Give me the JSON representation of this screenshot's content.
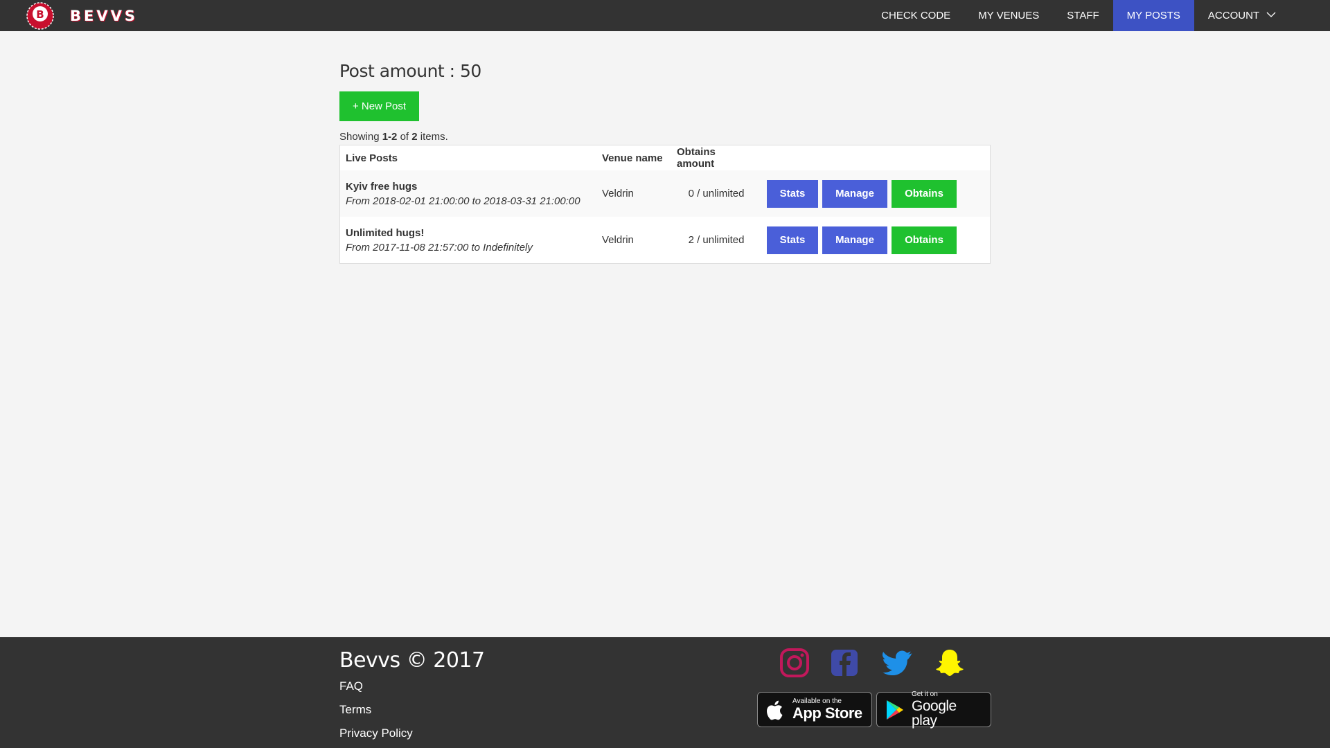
{
  "brand": {
    "name": "BEVVS"
  },
  "nav": {
    "items": [
      {
        "label": "CHECK CODE",
        "active": false
      },
      {
        "label": "MY VENUES",
        "active": false
      },
      {
        "label": "STAFF",
        "active": false
      },
      {
        "label": "MY POSTS",
        "active": true
      },
      {
        "label": "ACCOUNT",
        "active": false
      }
    ]
  },
  "main": {
    "title": "Post amount : 50",
    "new_post_label": "+ New Post",
    "summary": {
      "prefix": "Showing ",
      "range": "1-2",
      "of": " of ",
      "total": "2",
      "suffix": " items."
    },
    "table": {
      "headers": [
        "Live Posts",
        "Venue name",
        "Obtains amount"
      ],
      "rows": [
        {
          "title": "Kyiv free hugs",
          "range": "From 2018-02-01 21:00:00 to 2018-03-31 21:00:00",
          "venue": "Veldrin",
          "obtains": "0 / unlimited"
        },
        {
          "title": "Unlimited hugs!",
          "range": "From 2017-11-08 21:57:00 to Indefinitely",
          "venue": "Veldrin",
          "obtains": "2 / unlimited"
        }
      ],
      "actions": {
        "stats": "Stats",
        "manage": "Manage",
        "obtains": "Obtains"
      }
    }
  },
  "footer": {
    "copyright": "Bevvs © 2017",
    "links": [
      "FAQ",
      "Terms",
      "Privacy Policy"
    ],
    "social_icons": [
      "instagram-icon",
      "facebook-icon",
      "twitter-icon",
      "snapchat-icon"
    ],
    "app_store": {
      "small": "Available on the",
      "big": "App Store"
    },
    "google_play": {
      "small": "Get it on",
      "big": "Google play"
    }
  },
  "colors": {
    "navbar": "#333333",
    "active": "#3d52c4",
    "blue_button": "#4a5fd9",
    "green_button": "#1fc12f",
    "background": "#f4f4f4"
  }
}
